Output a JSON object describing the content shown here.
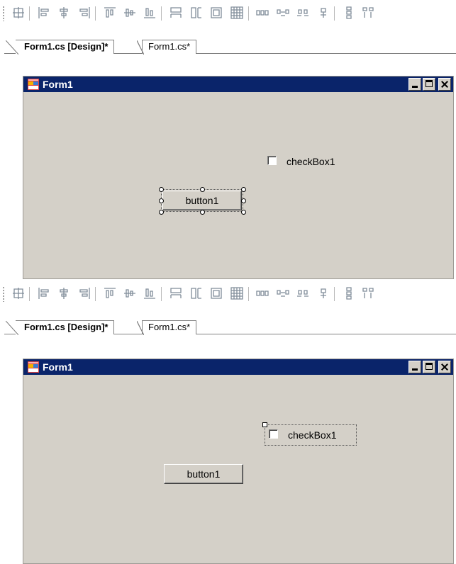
{
  "tabs": {
    "design_label": "Form1.cs [Design]*",
    "code_label": "Form1.cs*"
  },
  "form": {
    "title": "Form1",
    "checkbox_label": "checkBox1",
    "button_label": "button1"
  },
  "toolbar_icons": [
    "align-to-grid-icon",
    "align-lefts-icon",
    "align-centers-icon",
    "align-rights-icon",
    "align-tops-icon",
    "align-middles-icon",
    "align-bottoms-icon",
    "make-same-width-icon",
    "make-same-height-icon",
    "make-same-size-icon",
    "size-to-grid-icon",
    "make-horizontal-spacing-equal-icon",
    "increase-horizontal-spacing-icon",
    "decrease-horizontal-spacing-icon",
    "remove-horizontal-spacing-icon",
    "make-vertical-spacing-equal-icon",
    "increase-vertical-spacing-icon"
  ],
  "colors": {
    "titlebar": "#0a246a",
    "form_background": "#d4d0c8"
  },
  "states": {
    "top": {
      "selected_control": "button1"
    },
    "bottom": {
      "selected_control": "checkBox1"
    }
  }
}
